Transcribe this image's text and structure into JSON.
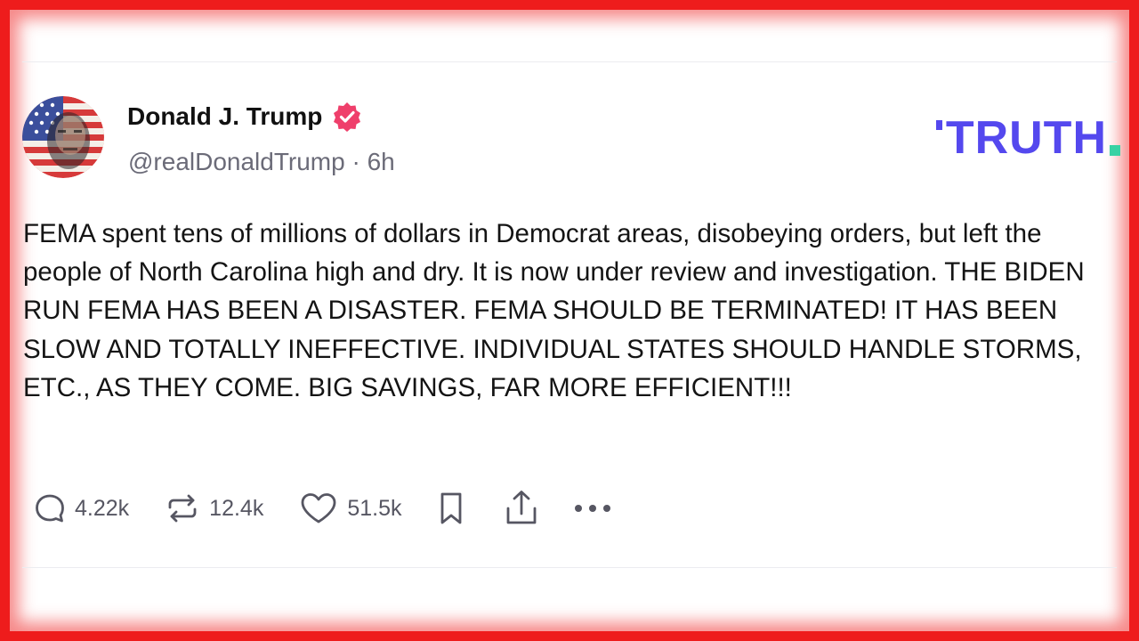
{
  "post": {
    "author": {
      "display_name": "Donald J. Trump",
      "handle": "@realDonaldTrump",
      "separator": "·",
      "time": "6h",
      "verified": true
    },
    "brand": {
      "name": "TRUTH",
      "text_color": "#5448ee",
      "dot_color": "#38d2a4"
    },
    "body": "FEMA spent tens of millions of dollars in Democrat areas, disobeying orders, but left the people of North Carolina high and dry. It is now under review and investigation. THE BIDEN RUN FEMA HAS BEEN A DISASTER. FEMA SHOULD BE TERMINATED! IT HAS BEEN SLOW AND TOTALLY INEFFECTIVE. INDIVIDUAL STATES SHOULD HANDLE STORMS, ETC., AS THEY COME. BIG SAVINGS, FAR MORE EFFICIENT!!!",
    "actions": {
      "reply": {
        "icon": "reply-bubble-icon",
        "count": "4.22k"
      },
      "retruth": {
        "icon": "repost-arrows-icon",
        "count": "12.4k"
      },
      "like": {
        "icon": "heart-icon",
        "count": "51.5k"
      },
      "bookmark": {
        "icon": "bookmark-icon"
      },
      "share": {
        "icon": "share-upload-icon"
      },
      "more": {
        "icon": "more-dots-icon"
      }
    }
  },
  "theme": {
    "frame_color": "#ee1c1c",
    "verified_badge_color": "#ef3f6b",
    "icon_color": "#565662"
  }
}
